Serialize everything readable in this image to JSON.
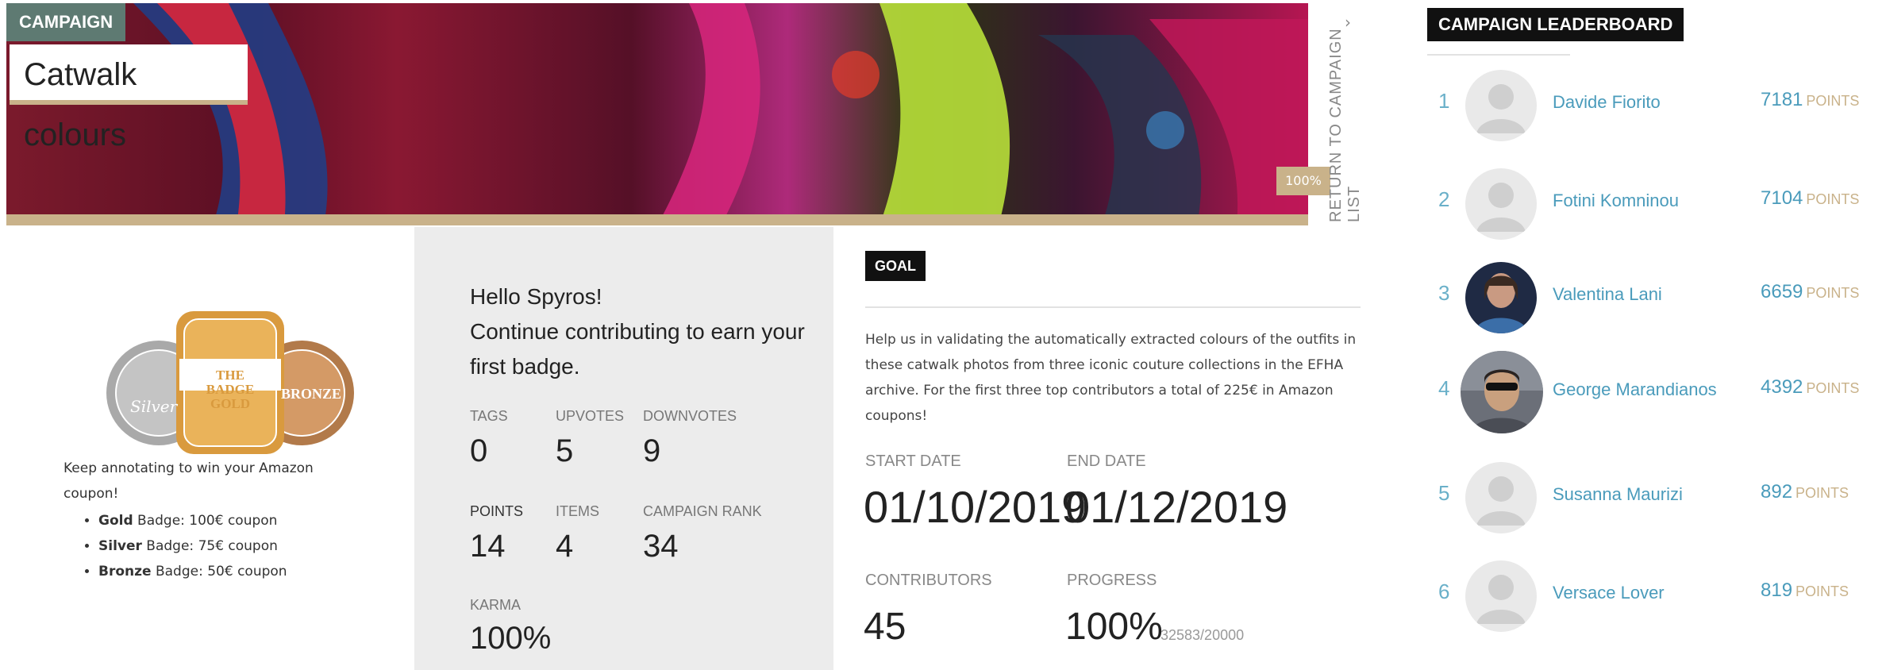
{
  "banner": {
    "campaign_tag": "CAMPAIGN",
    "title": "Catwalk colours",
    "progress_badge": "100%",
    "return_link": "RETURN TO CAMPAIGN LIST"
  },
  "badges": {
    "keep_text": "Keep annotating to win your Amazon coupon!",
    "coupons": [
      {
        "name": "Gold",
        "text": " Badge: 100€ coupon"
      },
      {
        "name": "Silver",
        "text": " Badge: 75€ coupon"
      },
      {
        "name": "Bronze",
        "text": " Badge: 50€ coupon"
      }
    ],
    "gold_text": "THE BADGE GOLD",
    "silver_text": "Silver",
    "bronze_text": "BRONZE"
  },
  "user": {
    "greeting": "Hello Spyros!",
    "message": "Continue contributing to earn your first badge.",
    "stats": {
      "tags_label": "TAGS",
      "tags": "0",
      "upvotes_label": "UPVOTES",
      "upvotes": "5",
      "downvotes_label": "DOWNVOTES",
      "downvotes": "9",
      "points_label": "POINTS",
      "points": "14",
      "items_label": "ITEMS",
      "items": "4",
      "rank_label": "CAMPAIGN RANK",
      "rank": "34",
      "karma_label": "KARMA",
      "karma": "100%"
    }
  },
  "goal": {
    "tag": "GOAL",
    "description": "Help us in validating the automatically extracted colours of the outfits in these catwalk photos from three iconic couture collections in the EFHA archive. For the first three top contributors a total of 225€ in Amazon coupons!",
    "start_label": "START DATE",
    "start_date": "01/10/2019",
    "end_label": "END DATE",
    "end_date": "01/12/2019",
    "contributors_label": "CONTRIBUTORS",
    "contributors": "45",
    "progress_label": "PROGRESS",
    "progress": "100%",
    "progress_detail": "32583/20000"
  },
  "leaderboard": {
    "title": "CAMPAIGN LEADERBOARD",
    "points_unit": "POINTS",
    "entries": [
      {
        "rank": "1",
        "name": "Davide Fiorito",
        "points": "7181",
        "avatar": "placeholder"
      },
      {
        "rank": "2",
        "name": "Fotini Komninou",
        "points": "7104",
        "avatar": "placeholder"
      },
      {
        "rank": "3",
        "name": "Valentina Lani",
        "points": "6659",
        "avatar": "photo"
      },
      {
        "rank": "4",
        "name": "George Marandianos",
        "points": "4392",
        "avatar": "photo"
      },
      {
        "rank": "5",
        "name": "Susanna Maurizi",
        "points": "892",
        "avatar": "placeholder"
      },
      {
        "rank": "6",
        "name": "Versace Lover",
        "points": "819",
        "avatar": "placeholder"
      }
    ]
  },
  "colors": {
    "accent_gold": "#c9b28a",
    "link_blue": "#4a9bbb",
    "campaign_tag_bg": "#5e7a72"
  }
}
